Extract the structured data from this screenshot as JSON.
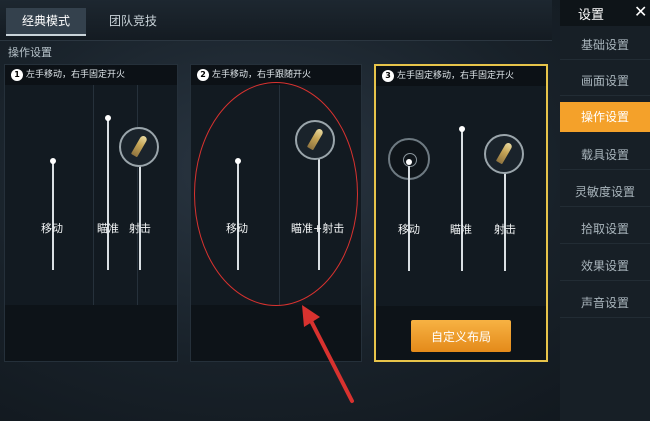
{
  "tabs": [
    "经典模式",
    "团队竞技"
  ],
  "section_title": "操作设置",
  "panels": [
    {
      "num": "1",
      "title": "左手移动，右手固定开火",
      "labels": [
        "移动",
        "瞄准",
        "射击"
      ]
    },
    {
      "num": "2",
      "title": "左手移动，右手跟随开火",
      "labels": [
        "移动",
        "瞄准+射击"
      ]
    },
    {
      "num": "3",
      "title": "左手固定移动，右手固定开火",
      "labels": [
        "移动",
        "瞄准",
        "射击"
      ],
      "button": "自定义布局"
    }
  ],
  "sidebar": {
    "title": "设置",
    "close": "✕",
    "items": [
      "基础设置",
      "画面设置",
      "操作设置",
      "载具设置",
      "灵敏度设置",
      "拾取设置",
      "效果设置",
      "声音设置"
    ],
    "active_index": 2
  },
  "colors": {
    "accent": "#f4a12a",
    "selected_border": "#e7c44a",
    "annotation": "#d8322f"
  }
}
